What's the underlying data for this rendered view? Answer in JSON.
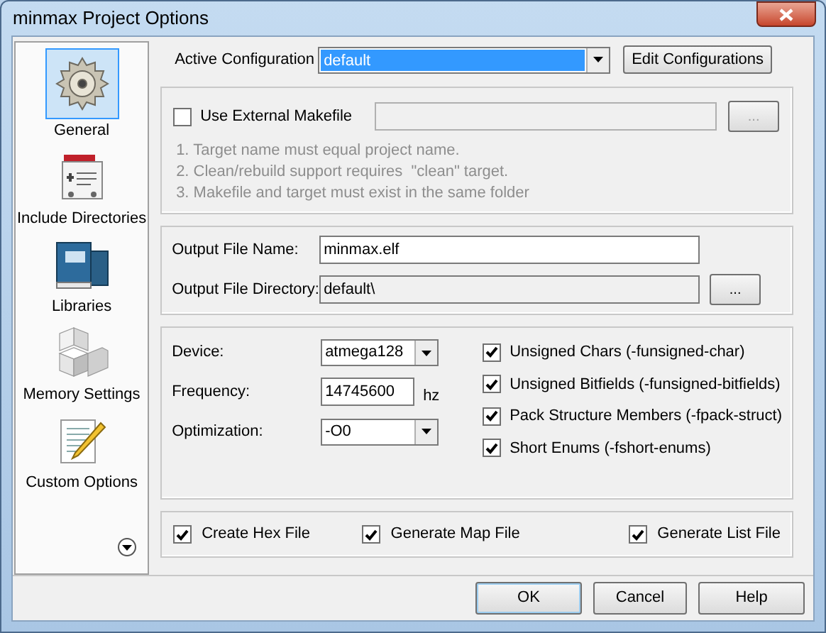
{
  "window": {
    "title": "minmax Project Options"
  },
  "sidebar": {
    "items": [
      {
        "label": "General",
        "selected": true
      },
      {
        "label": "Include Directories",
        "selected": false
      },
      {
        "label": "Libraries",
        "selected": false
      },
      {
        "label": "Memory Settings",
        "selected": false
      },
      {
        "label": "Custom Options",
        "selected": false
      }
    ]
  },
  "active_configuration": {
    "label": "Active Configuration",
    "value": "default",
    "button": "Edit Configurations"
  },
  "external_makefile": {
    "label": "Use External Makefile",
    "checked": false,
    "browse_button": "...",
    "notes": [
      "1. Target name must equal project name.",
      "2. Clean/rebuild support requires  \"clean\" target.",
      "3. Makefile and target must exist in the same folder"
    ]
  },
  "output": {
    "name_label": "Output File Name:",
    "name_value": "minmax.elf",
    "dir_label": "Output File Directory:",
    "dir_value": "default\\",
    "browse_button": "..."
  },
  "device": {
    "fields": [
      {
        "kind": "select",
        "label": "Device:",
        "value": "atmega128"
      },
      {
        "kind": "text",
        "label": "Frequency:",
        "value": "14745600",
        "unit": "hz"
      },
      {
        "kind": "select",
        "label": "Optimization:",
        "value": "-O0"
      }
    ],
    "flags": [
      {
        "label": "Unsigned Chars (-funsigned-char)",
        "checked": true
      },
      {
        "label": "Unsigned Bitfields (-funsigned-bitfields)",
        "checked": true
      },
      {
        "label": "Pack Structure Members (-fpack-struct)",
        "checked": true
      },
      {
        "label": "Short Enums (-fshort-enums)",
        "checked": true
      }
    ]
  },
  "output_files": [
    {
      "label": "Create Hex File",
      "checked": true
    },
    {
      "label": "Generate Map File",
      "checked": true
    },
    {
      "label": "Generate List File",
      "checked": true
    }
  ],
  "buttons": [
    "OK",
    "Cancel",
    "Help"
  ]
}
